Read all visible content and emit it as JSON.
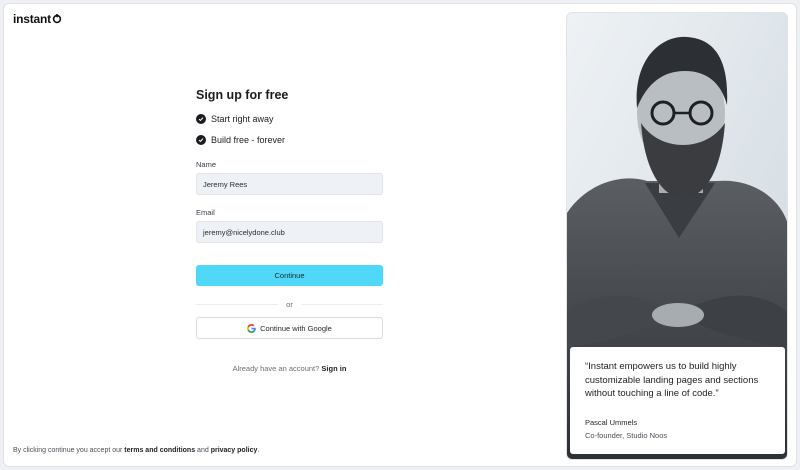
{
  "brand": {
    "logo_text": "instant",
    "accent_color": "#4fd8f7"
  },
  "form": {
    "title": "Sign up for free",
    "bullets": [
      "Start right away",
      "Build free - forever"
    ],
    "name_label": "Name",
    "name_value": "Jeremy Rees",
    "email_label": "Email",
    "email_value": "jeremy@nicelydone.club",
    "continue_label": "Continue",
    "divider_text": "or",
    "google_label": "Continue with Google",
    "signin_prompt": "Already have an account?",
    "signin_link": "Sign in"
  },
  "footer": {
    "terms_prefix": "By clicking continue you accept our",
    "terms_link": "terms and conditions",
    "and_text": "and",
    "privacy_link": "privacy policy",
    "period": "."
  },
  "testimonial": {
    "quote": "“Instant empowers us to build highly customizable landing pages and sections without touching a line of code.”",
    "author": "Pascal Ummels",
    "role": "Co-founder, Studio Noos"
  }
}
